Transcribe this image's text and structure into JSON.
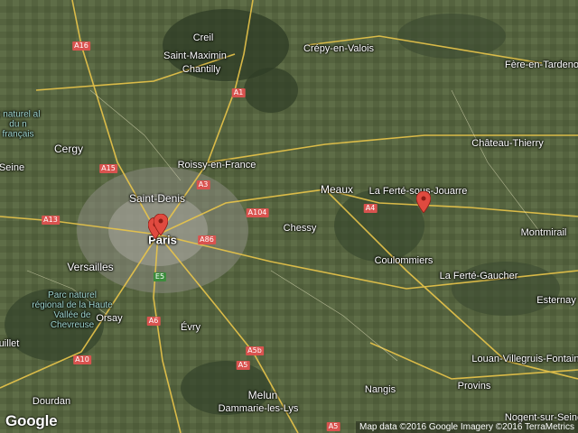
{
  "map": {
    "places": [
      {
        "id": "creil",
        "name": "Creil",
        "cls": ""
      },
      {
        "id": "saint-maximin",
        "name": "Saint-Maximin",
        "cls": ""
      },
      {
        "id": "chantilly",
        "name": "Chantilly",
        "cls": ""
      },
      {
        "id": "crepy",
        "name": "Crépy-en-Valois",
        "cls": ""
      },
      {
        "id": "fere",
        "name": "Fère-en-Tardeno",
        "cls": ""
      },
      {
        "id": "chateau",
        "name": "Château-Thierry",
        "cls": ""
      },
      {
        "id": "cergy",
        "name": "Cergy",
        "cls": "big"
      },
      {
        "id": "roissy",
        "name": "Roissy-en-France",
        "cls": ""
      },
      {
        "id": "saint-denis",
        "name": "Saint-Denis",
        "cls": "big"
      },
      {
        "id": "meaux",
        "name": "Meaux",
        "cls": "big"
      },
      {
        "id": "laferte",
        "name": "La Ferté-sous-Jouarre",
        "cls": ""
      },
      {
        "id": "paris",
        "name": "Paris",
        "cls": "city"
      },
      {
        "id": "chessy",
        "name": "Chessy",
        "cls": ""
      },
      {
        "id": "montmirail",
        "name": "Montmirail",
        "cls": ""
      },
      {
        "id": "versailles",
        "name": "Versailles",
        "cls": "big"
      },
      {
        "id": "coulommiers",
        "name": "Coulommiers",
        "cls": ""
      },
      {
        "id": "lafertegaucher",
        "name": "La Ferté-Gaucher",
        "cls": ""
      },
      {
        "id": "esternay",
        "name": "Esternay",
        "cls": ""
      },
      {
        "id": "orsay",
        "name": "Orsay",
        "cls": ""
      },
      {
        "id": "evry",
        "name": "Évry",
        "cls": ""
      },
      {
        "id": "louan",
        "name": "Louan-Villegruis-Fontaine",
        "cls": ""
      },
      {
        "id": "provins",
        "name": "Provins",
        "cls": ""
      },
      {
        "id": "nangis",
        "name": "Nangis",
        "cls": ""
      },
      {
        "id": "melun",
        "name": "Melun",
        "cls": "big"
      },
      {
        "id": "dammarie",
        "name": "Dammarie-les-Lys",
        "cls": ""
      },
      {
        "id": "dourdan",
        "name": "Dourdan",
        "cls": ""
      },
      {
        "id": "nogent",
        "name": "Nogent-sur-Seine",
        "cls": ""
      },
      {
        "id": "uillet",
        "name": "uillet",
        "cls": ""
      },
      {
        "id": "seine",
        "name": "Seine",
        "cls": ""
      }
    ],
    "parks": [
      {
        "id": "pnr-vexin",
        "name": "ç naturel al du n français"
      },
      {
        "id": "pnr-chevreuse",
        "name": "Parc naturel régional de la Haute Vallée de Chevreuse"
      }
    ],
    "shields": [
      {
        "id": "a16",
        "label": "A16",
        "color": "red"
      },
      {
        "id": "a1",
        "label": "A1",
        "color": "red"
      },
      {
        "id": "a15",
        "label": "A15",
        "color": "red"
      },
      {
        "id": "a3",
        "label": "A3",
        "color": "red"
      },
      {
        "id": "a104",
        "label": "A104",
        "color": "red"
      },
      {
        "id": "a4",
        "label": "A4",
        "color": "red"
      },
      {
        "id": "a13",
        "label": "A13",
        "color": "red"
      },
      {
        "id": "a86",
        "label": "A86",
        "color": "red"
      },
      {
        "id": "e5",
        "label": "E5",
        "color": "green"
      },
      {
        "id": "a6",
        "label": "A6",
        "color": "red"
      },
      {
        "id": "a10",
        "label": "A10",
        "color": "red"
      },
      {
        "id": "a5b",
        "label": "A5b",
        "color": "red"
      },
      {
        "id": "a5",
        "label": "A5",
        "color": "red"
      },
      {
        "id": "a5-2",
        "label": "A5",
        "color": "red"
      }
    ],
    "markers": [
      "paris-marker-1",
      "paris-marker-2",
      "laferte-marker"
    ],
    "marker_color": "#e04a3f"
  },
  "branding": {
    "logo": "Google",
    "attribution": "Map data ©2016 Google Imagery ©2016 TerraMetrics"
  }
}
